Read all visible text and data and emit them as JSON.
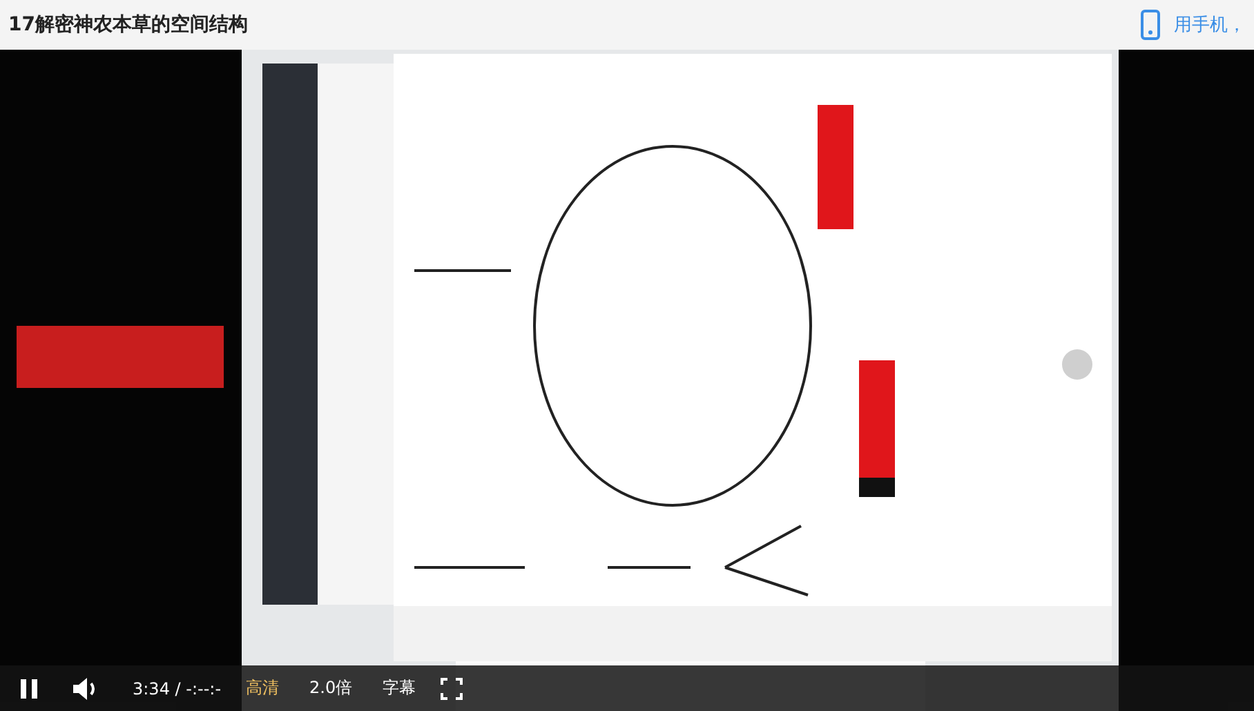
{
  "page": {
    "title": "17解密神农本草的空间结构",
    "mobile_link": "用手机，"
  },
  "controls": {
    "playing": true,
    "time": "3:34 / -:--:-",
    "quality": {
      "label": "高清",
      "selected": true
    },
    "speed": "2.0倍",
    "subtitles": "字幕"
  }
}
